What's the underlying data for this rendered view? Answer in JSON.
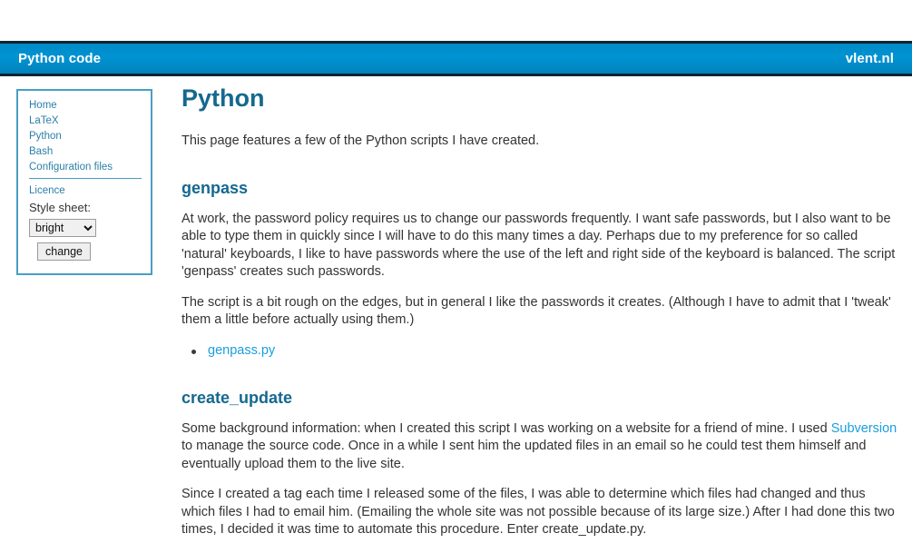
{
  "header": {
    "title": "Python code",
    "site": "vlent.nl"
  },
  "sidebar": {
    "nav_items": [
      {
        "label": "Home"
      },
      {
        "label": "LaTeX"
      },
      {
        "label": "Python"
      },
      {
        "label": "Bash"
      },
      {
        "label": "Configuration files"
      }
    ],
    "licence_label": "Licence",
    "style_sheet_label": "Style sheet:",
    "style_select": {
      "selected": "bright",
      "options": [
        "bright"
      ]
    },
    "change_button_label": "change"
  },
  "content": {
    "page_title": "Python",
    "intro": "This page features a few of the Python scripts I have created.",
    "sections": [
      {
        "heading": "genpass",
        "paragraph_1": "At work, the password policy requires us to change our passwords frequently. I want safe passwords, but I also want to be able to type them in quickly since I will have to do this many times a day. Perhaps due to my preference for so called 'natural' keyboards, I like to have passwords where the use of the left and right side of the keyboard is balanced. The script 'genpass' creates such passwords.",
        "paragraph_2": "The script is a bit rough on the edges, but in general I like the passwords it creates. (Although I have to admit that I 'tweak' them a little before actually using them.)",
        "links": [
          {
            "label": "genpass.py"
          }
        ]
      },
      {
        "heading": "create_update",
        "paragraph_1_before_link": "Some background information: when I created this script I was working on a website for a friend of mine. I used ",
        "paragraph_1_link": "Subversion",
        "paragraph_1_after_link": " to manage the source code. Once in a while I sent him the updated files in an email so he could test them himself and eventually upload them to the live site.",
        "paragraph_2": "Since I created a tag each time I released some of the files, I was able to determine which files had changed and thus which files I had to email him. (Emailing the whole site was not possible because of its large size.) After I had done this two times, I decided it was time to automate this procedure. Enter create_update.py."
      }
    ]
  }
}
